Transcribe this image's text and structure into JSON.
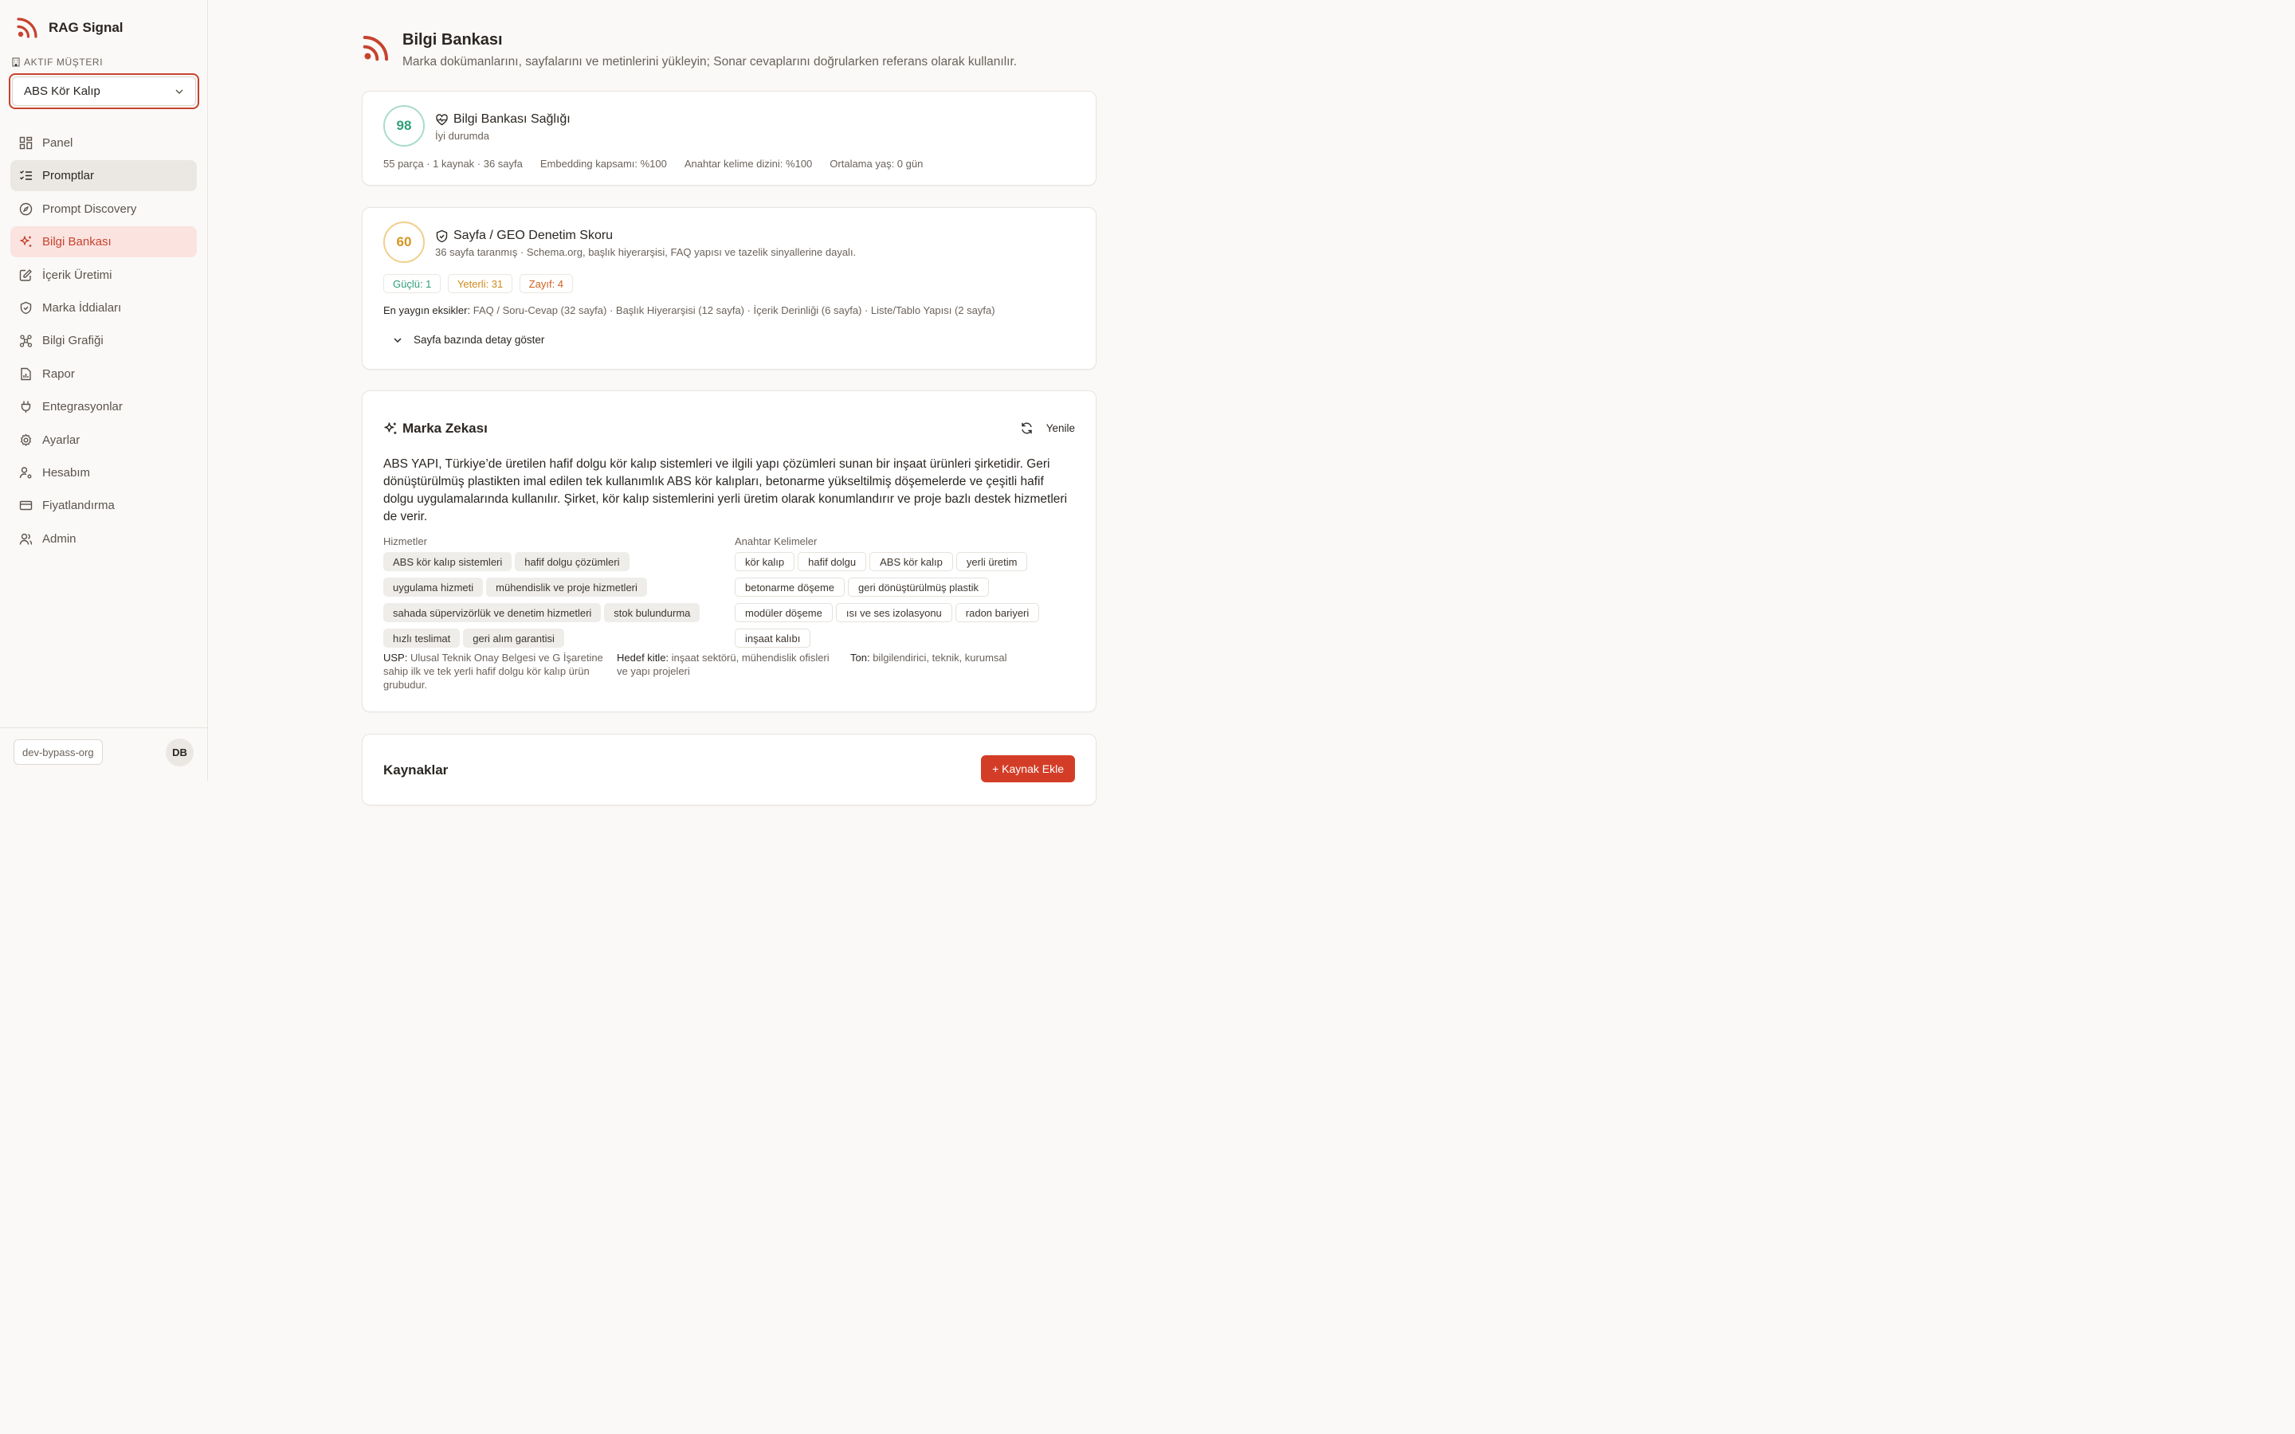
{
  "app": {
    "name": "RAG Signal"
  },
  "customer": {
    "label": "AKTIF MÜŞTERI",
    "selected": "ABS Kör Kalıp"
  },
  "nav": [
    {
      "label": "Panel",
      "icon": "grid-icon"
    },
    {
      "label": "Promptlar",
      "icon": "list-check-icon"
    },
    {
      "label": "Prompt Discovery",
      "icon": "compass-icon"
    },
    {
      "label": "Bilgi Bankası",
      "icon": "sparkle-icon"
    },
    {
      "label": "İçerik Üretimi",
      "icon": "edit-icon"
    },
    {
      "label": "Marka İddiaları",
      "icon": "shield-icon"
    },
    {
      "label": "Bilgi Grafiği",
      "icon": "graph-icon"
    },
    {
      "label": "Rapor",
      "icon": "report-icon"
    },
    {
      "label": "Entegrasyonlar",
      "icon": "plug-icon"
    },
    {
      "label": "Ayarlar",
      "icon": "gear-icon"
    },
    {
      "label": "Hesabım",
      "icon": "user-gear-icon"
    },
    {
      "label": "Fiyatlandırma",
      "icon": "credit-card-icon"
    },
    {
      "label": "Admin",
      "icon": "users-icon"
    }
  ],
  "footer": {
    "org": "dev-bypass-org",
    "avatar": "DB"
  },
  "page": {
    "title": "Bilgi Bankası",
    "subtitle": "Marka dokümanlarını, sayfalarını ve metinlerini yükleyin; Sonar cevaplarını doğrularken referans olarak kullanılır."
  },
  "health": {
    "score": "98",
    "title": "Bilgi Bankası Sağlığı",
    "status": "İyi durumda",
    "stats": [
      "55 parça · 1 kaynak · 36 sayfa",
      "Embedding kapsamı: %100",
      "Anahtar kelime dizini: %100",
      "Ortalama yaş: 0 gün"
    ],
    "colors": {
      "score": "#2f9e7a"
    }
  },
  "audit": {
    "score": "60",
    "title": "Sayfa / GEO Denetim Skoru",
    "subtitle": "36 sayfa taranmış · Schema.org, başlık hiyerarşisi, FAQ yapısı ve tazelik sinyallerine dayalı.",
    "pills": [
      {
        "label": "Güçlü: 1",
        "color": "#2f9e7a"
      },
      {
        "label": "Yeterli: 31",
        "color": "#d08a1e"
      },
      {
        "label": "Zayıf: 4",
        "color": "#d0601e"
      }
    ],
    "missing_label": "En yaygın eksikler:",
    "missing_text": "FAQ / Soru-Cevap (32 sayfa) · Başlık Hiyerarşisi (12 sayfa) · İçerik Derinliği (6 sayfa) · Liste/Tablo Yapısı (2 sayfa)",
    "toggle": "Sayfa bazında detay göster",
    "colors": {
      "score": "#e0a534"
    }
  },
  "brand": {
    "title": "Marka Zekası",
    "refresh": "Yenile",
    "description": "ABS YAPI, Türkiye’de üretilen hafif dolgu kör kalıp sistemleri ve ilgili yapı çözümleri sunan bir inşaat ürünleri şirketidir. Geri dönüştürülmüş plastikten imal edilen tek kullanımlık ABS kör kalıpları, betonarme yükseltilmiş döşemelerde ve çeşitli hafif dolgu uygulamalarında kullanılır. Şirket, kör kalıp sistemlerini yerli üretim olarak konumlandırır ve proje bazlı destek hizmetleri de verir.",
    "services_label": "Hizmetler",
    "services": [
      "ABS kör kalıp sistemleri",
      "hafif dolgu çözümleri",
      "uygulama hizmeti",
      "mühendislik ve proje hizmetleri",
      "sahada süpervizörlük ve denetim hizmetleri",
      "stok bulundurma",
      "hızlı teslimat",
      "geri alım garantisi"
    ],
    "keywords_label": "Anahtar Kelimeler",
    "keywords": [
      "kör kalıp",
      "hafif dolgu",
      "ABS kör kalıp",
      "yerli üretim",
      "betonarme döşeme",
      "geri dönüştürülmüş plastik",
      "modüler döşeme",
      "ısı ve ses izolasyonu",
      "radon bariyeri",
      "inşaat kalıbı"
    ],
    "usp_label": "USP:",
    "usp": "Ulusal Teknik Onay Belgesi ve G İşaretine sahip ilk ve tek yerli hafif dolgu kör kalıp ürün grubudur.",
    "audience_label": "Hedef kitle:",
    "audience": "inşaat sektörü, mühendislik ofisleri ve yapı projeleri",
    "tone_label": "Ton:",
    "tone": "bilgilendirici, teknik, kurumsal"
  },
  "sources": {
    "title": "Kaynaklar",
    "add_button": "+ Kaynak Ekle"
  },
  "colors": {
    "accent": "#c7432e",
    "button": "#d33d27"
  }
}
